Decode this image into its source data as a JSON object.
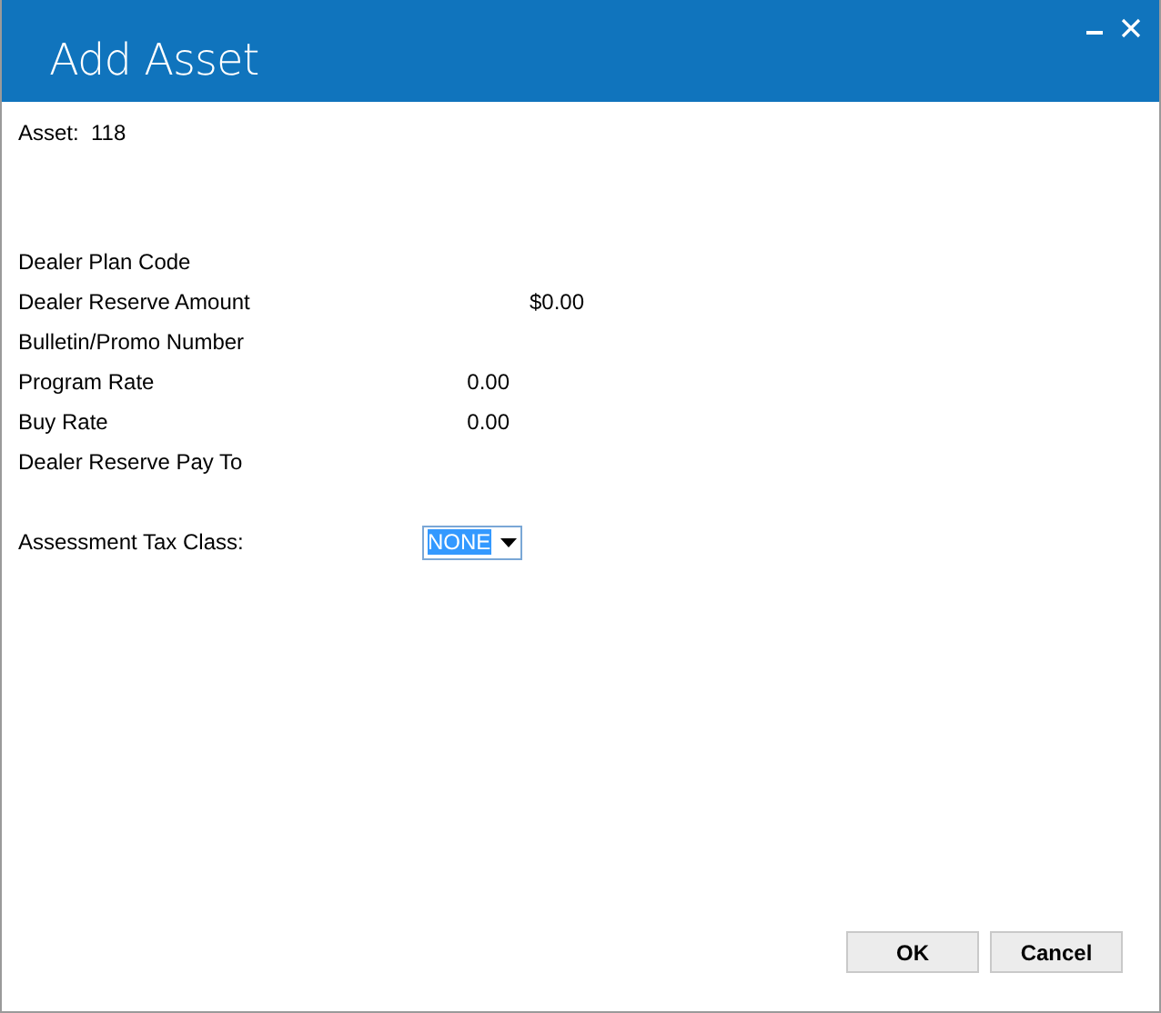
{
  "window": {
    "title": "Add Asset"
  },
  "asset": {
    "label": "Asset:",
    "value": "118"
  },
  "fields": [
    {
      "label": "Dealer Plan Code",
      "kind": "empty"
    },
    {
      "label": "Dealer Reserve Amount",
      "kind": "currency",
      "value": "$0.00"
    },
    {
      "label": "Bulletin/Promo Number",
      "kind": "empty"
    },
    {
      "label": "Program Rate",
      "kind": "rate",
      "value": "0.00"
    },
    {
      "label": "Buy Rate",
      "kind": "rate",
      "value": "0.00"
    },
    {
      "label": "Dealer Reserve Pay To",
      "kind": "empty"
    }
  ],
  "tax_class": {
    "label": "Assessment Tax Class:",
    "value": "NONE",
    "text_selected": true
  },
  "buttons": [
    "OK",
    "Cancel"
  ]
}
